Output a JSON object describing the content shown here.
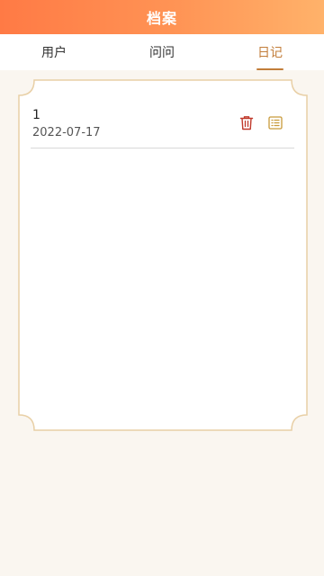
{
  "header": {
    "title": "档案"
  },
  "tabs": [
    {
      "label": "用户",
      "active": false
    },
    {
      "label": "问问",
      "active": false
    },
    {
      "label": "日记",
      "active": true
    }
  ],
  "colors": {
    "accent": "#c27d3a",
    "header_gradient_start": "#ff7a45",
    "header_gradient_end": "#ffb26a",
    "delete_icon": "#c0392b",
    "detail_icon": "#c89a3a",
    "card_border": "#e8cfa5"
  },
  "diary": {
    "entries": [
      {
        "title": "1",
        "date": "2022-07-17",
        "actions": [
          {
            "icon": "trash-icon"
          },
          {
            "icon": "list-detail-icon"
          }
        ]
      }
    ]
  }
}
